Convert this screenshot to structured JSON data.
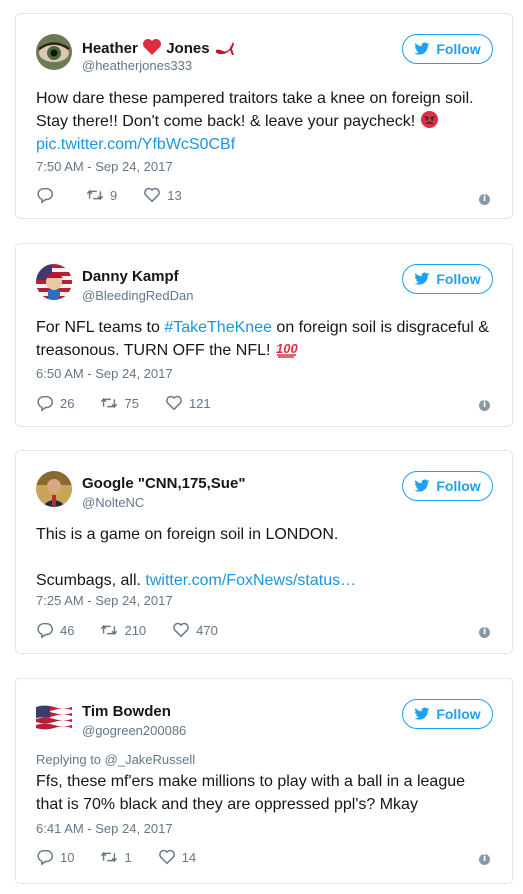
{
  "colors": {
    "accent": "#1da1f2",
    "link": "#1b95e0",
    "secondary": "#657786",
    "border": "#e1e8ed"
  },
  "tweets": [
    {
      "name_part1": "Heather",
      "name_part2": "Jones",
      "name_emojis": [
        "heart",
        "high-heel"
      ],
      "handle": "@heatherjones333",
      "follow_label": "Follow",
      "text_line1": "How dare these pampered traitors take a knee on foreign soil.",
      "text_line2": "Stay there!! Don't come back! & leave your paycheck!",
      "link": "pic.twitter.com/YfbWcS0CBf",
      "time": "7:50 AM - Sep 24, 2017",
      "replies": "",
      "retweets": "9",
      "likes": "13"
    },
    {
      "name": "Danny Kampf",
      "handle": "@BleedingRedDan",
      "follow_label": "Follow",
      "text_pre": "For NFL teams to ",
      "hashtag": "#TakeTheKnee",
      "text_post": " on foreign soil is disgraceful &",
      "text_line2": "treasonous. TURN OFF the NFL!",
      "time": "6:50 AM - Sep 24, 2017",
      "replies": "26",
      "retweets": "75",
      "likes": "121"
    },
    {
      "name": "Google \"CNN,175,Sue\"",
      "handle": "@NolteNC",
      "follow_label": "Follow",
      "text_line1": "This is a game on foreign soil in LONDON.",
      "text_line2_pre": "Scumbags, all. ",
      "link": "twitter.com/FoxNews/status…",
      "time": "7:25 AM - Sep 24, 2017",
      "replies": "46",
      "retweets": "210",
      "likes": "470"
    },
    {
      "name": "Tim Bowden",
      "handle": "@gogreen200086",
      "follow_label": "Follow",
      "reply_to": "Replying to @_JakeRussell",
      "text_line1": "Ffs, these mf'ers make millions to play with a ball in a league",
      "text_line2": "that is 70% black and they are oppressed ppl's? Mkay",
      "time": "6:41 AM - Sep 24, 2017",
      "replies": "10",
      "retweets": "1",
      "likes": "14"
    }
  ]
}
